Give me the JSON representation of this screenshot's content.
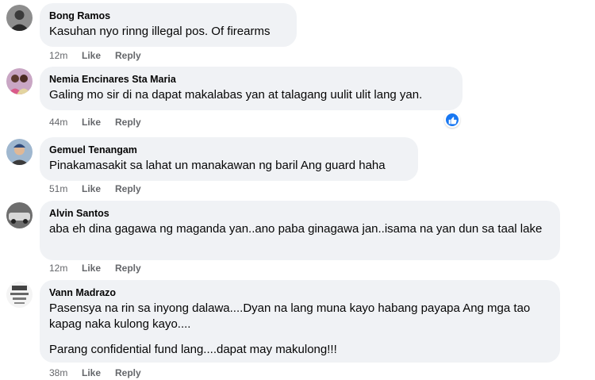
{
  "comments": [
    {
      "name": "Bong Ramos",
      "texts": [
        "Kasuhan nyo rinng illegal pos. Of firearms"
      ],
      "time": "12m",
      "like_label": "Like",
      "reply_label": "Reply"
    },
    {
      "name": "Nemia Encinares Sta Maria",
      "texts": [
        "Galing mo sir di na dapat makalabas yan at talagang uulit ulit lang yan."
      ],
      "time": "44m",
      "like_label": "Like",
      "reply_label": "Reply",
      "reaction": "like-reaction-icon"
    },
    {
      "name": "Gemuel Tenangam",
      "texts": [
        "Pinakamasakit sa lahat un manakawan ng baril Ang guard haha"
      ],
      "time": "51m",
      "like_label": "Like",
      "reply_label": "Reply"
    },
    {
      "name": "Alvin Santos",
      "texts": [
        "aba eh dina gagawa ng maganda yan..ano paba ginagawa jan..isama na yan dun sa taal lake"
      ],
      "time": "12m",
      "like_label": "Like",
      "reply_label": "Reply"
    },
    {
      "name": "Vann Madrazo",
      "texts": [
        "Pasensya na rin sa inyong dalawa....Dyan na lang muna kayo habang payapa Ang mga tao kapag naka kulong kayo....",
        "Parang confidential fund lang....dapat may makulong!!!"
      ],
      "time": "38m",
      "like_label": "Like",
      "reply_label": "Reply"
    }
  ],
  "colors": {
    "bubble": "#f0f2f5",
    "meta_text": "#65676b",
    "reaction_blue": "#1877f2"
  }
}
